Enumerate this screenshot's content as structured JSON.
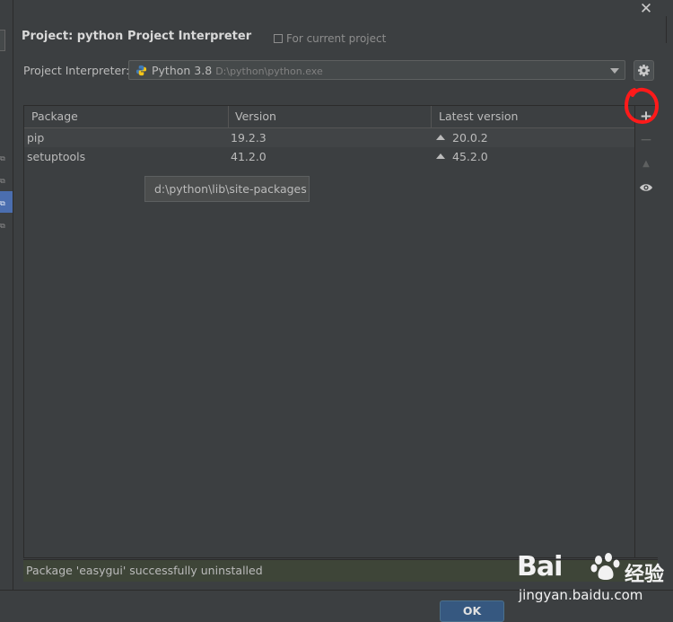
{
  "window": {
    "close_symbol": "✕"
  },
  "breadcrumb": {
    "project": "Project: python",
    "separator": "›",
    "page": "Project Interpreter"
  },
  "scope_note": "For current project",
  "interpreter": {
    "label": "Project Interpreter:",
    "name": "Python 3.8",
    "path": "D:\\python\\python.exe"
  },
  "table": {
    "columns": [
      "Package",
      "Version",
      "Latest version"
    ],
    "rows": [
      {
        "package": "pip",
        "version": "19.2.3",
        "latest": "20.0.2"
      },
      {
        "package": "setuptools",
        "version": "41.2.0",
        "latest": "45.2.0"
      }
    ]
  },
  "tooltip": "d:\\python\\lib\\site-packages",
  "toolbar": {
    "add": "+",
    "remove": "−",
    "upgrade": "▲",
    "show": "eye-icon"
  },
  "status_message": "Package 'easygui' successfully uninstalled",
  "buttons": {
    "ok": "OK"
  },
  "watermark": {
    "brand": "Bai",
    "brand_suffix": "经验",
    "url": "jingyan.baidu.com"
  },
  "colors": {
    "annotation": "#ff1a1a",
    "status_bg": "#3e4538",
    "ok_bg": "#365880",
    "selection": "#4b6eaf"
  }
}
